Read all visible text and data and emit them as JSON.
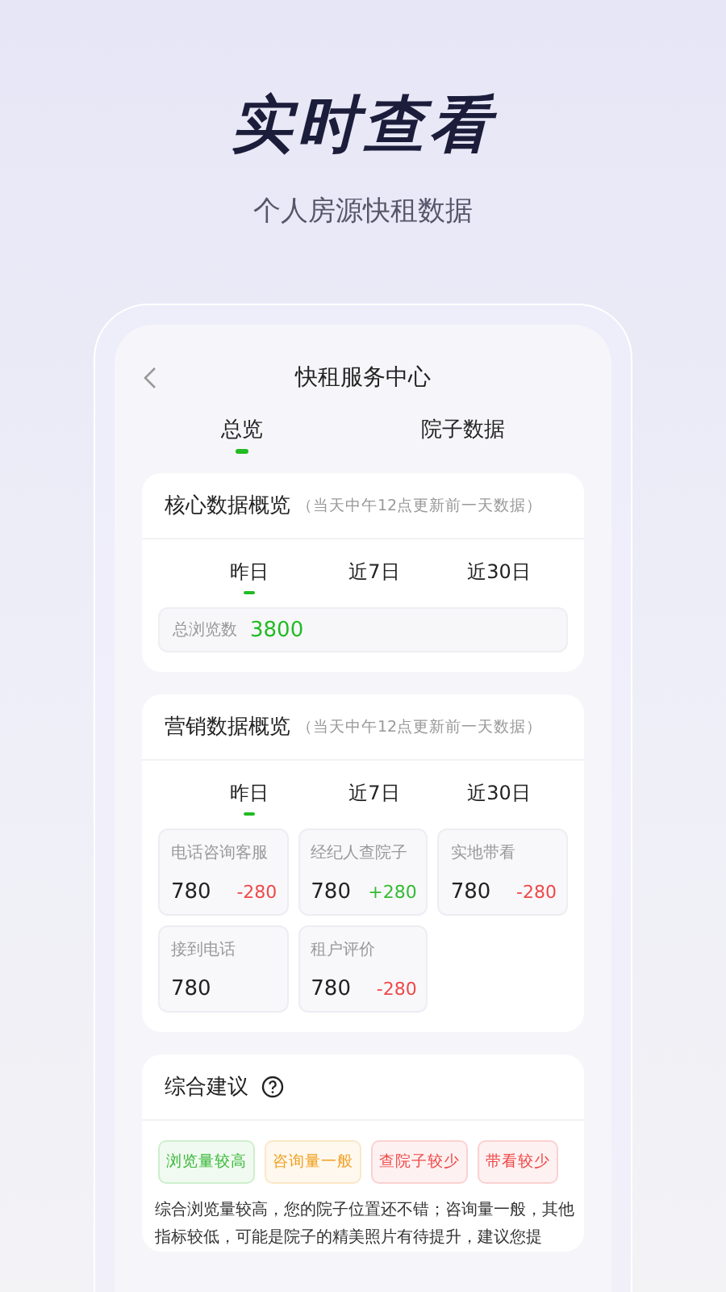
{
  "headline": "实时查看",
  "subtitle": "个人房源快租数据",
  "nav": {
    "title": "快租服务中心"
  },
  "tabs": [
    {
      "label": "总览",
      "selected": true
    },
    {
      "label": "院子数据",
      "selected": false
    }
  ],
  "core": {
    "title": "核心数据概览",
    "note": "（当天中午12点更新前一天数据）",
    "periods": [
      {
        "label": "昨日",
        "selected": true
      },
      {
        "label": "近7日",
        "selected": false
      },
      {
        "label": "近30日",
        "selected": false
      }
    ],
    "stat": {
      "label": "总浏览数",
      "value": "3800"
    }
  },
  "marketing": {
    "title": "营销数据概览",
    "note": "（当天中午12点更新前一天数据）",
    "periods": [
      {
        "label": "昨日",
        "selected": true
      },
      {
        "label": "近7日",
        "selected": false
      },
      {
        "label": "近30日",
        "selected": false
      }
    ],
    "metrics": [
      {
        "label": "电话咨询客服",
        "value": "780",
        "delta": "-280",
        "kind": "down"
      },
      {
        "label": "经纪人查院子",
        "value": "780",
        "delta": "+280",
        "kind": "up"
      },
      {
        "label": "实地带看",
        "value": "780",
        "delta": "-280",
        "kind": "down"
      },
      {
        "label": "接到电话",
        "value": "780"
      },
      {
        "label": "租户评价",
        "value": "780",
        "delta": "-280",
        "kind": "down"
      }
    ]
  },
  "advice": {
    "title": "综合建议",
    "tags": [
      {
        "label": "浏览量较高",
        "color": "#3cb93c"
      },
      {
        "label": "咨询量一般",
        "color": "#f0a020"
      },
      {
        "label": "查院子较少",
        "color": "#f04848"
      },
      {
        "label": "带看较少",
        "color": "#f04848"
      }
    ],
    "text": "综合浏览量较高，您的院子位置还不错；咨询量一般，其他指标较低，可能是院子的精美照片有待提升，建议您提"
  }
}
